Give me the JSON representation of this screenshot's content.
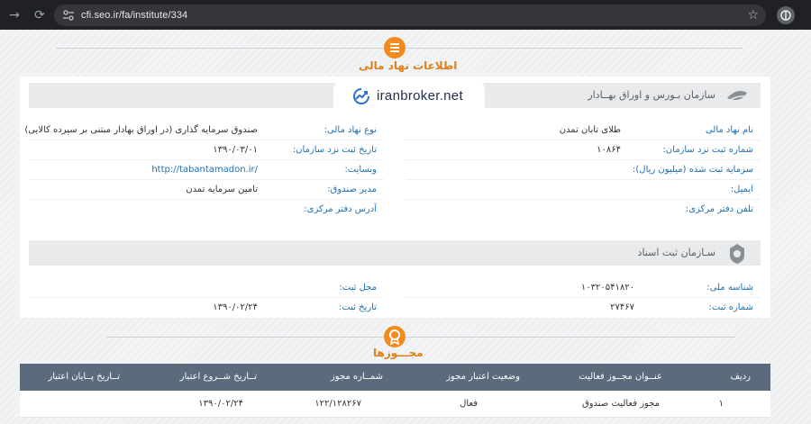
{
  "browser": {
    "url": "cfi.seo.ir/fa/institute/334",
    "back_icon": "→",
    "reload_icon": "⟳",
    "star_icon": "☆"
  },
  "section_institution": {
    "title": "اطلاعات نهاد مالی"
  },
  "seo_bar": {
    "name": "سازمان بـورس و اوراق بهــادار"
  },
  "watermark": {
    "text": "iranbroker.net"
  },
  "fields_right": [
    {
      "label": "نام نهاد مالی",
      "value": "طلای تابان تمدن"
    },
    {
      "label": "شماره ثبت نزد سازمان:",
      "value": "۱۰۸۶۴"
    },
    {
      "label": "سرمایه ثبت شده (میلیون ریال):",
      "value": ""
    },
    {
      "label": "ایمیل:",
      "value": ""
    },
    {
      "label": "تلفن دفتر مرکزی:",
      "value": ""
    }
  ],
  "fields_left": [
    {
      "label": "نوع نهاد مالی:",
      "value": "صندوق سرمایه گذاری (در اوراق بهادار مبتنی بر سپرده کالایی)"
    },
    {
      "label": "تاریخ ثبت نزد سازمان:",
      "value": "۱۳۹۰/۰۳/۰۱"
    },
    {
      "label": "وبسایت:",
      "value": "http://tabantamadon.ir/"
    },
    {
      "label": "مدیر صندوق:",
      "value": "تامین سرمایه تمدن"
    },
    {
      "label": "آدرس دفتر مرکزی:",
      "value": ""
    }
  ],
  "registry_bar": {
    "name": "سـازمان ثبت اسناد"
  },
  "registry_right": [
    {
      "label": "شناسه ملی:",
      "value": "۱۰۳۲۰۵۴۱۸۲۰"
    },
    {
      "label": "شماره ثبت:",
      "value": "۲۷۴۶۷"
    }
  ],
  "registry_left": [
    {
      "label": "محل ثبت:",
      "value": ""
    },
    {
      "label": "تاریخ ثبت:",
      "value": "۱۳۹۰/۰۲/۲۴"
    }
  ],
  "section_licenses": {
    "title": "مجـــوزها"
  },
  "licenses_table": {
    "headers": [
      "ردیف",
      "عنــوان مجــوز فعالیت",
      "وضعیت اعتبار مجوز",
      "شمــاره مجوز",
      "تــاریخ شــروع اعتبار",
      "تــاریخ پــایان اعتبار"
    ],
    "rows": [
      [
        "۱",
        "مجوز فعالیت صندوق",
        "فعال",
        "۱۲۲/۱۲۸۲۶۷",
        "۱۳۹۰/۰۲/۲۴",
        ""
      ]
    ]
  },
  "colors": {
    "accent": "#f28a1e",
    "label_blue": "#1e6fb5",
    "table_header": "#5b6b7c"
  }
}
